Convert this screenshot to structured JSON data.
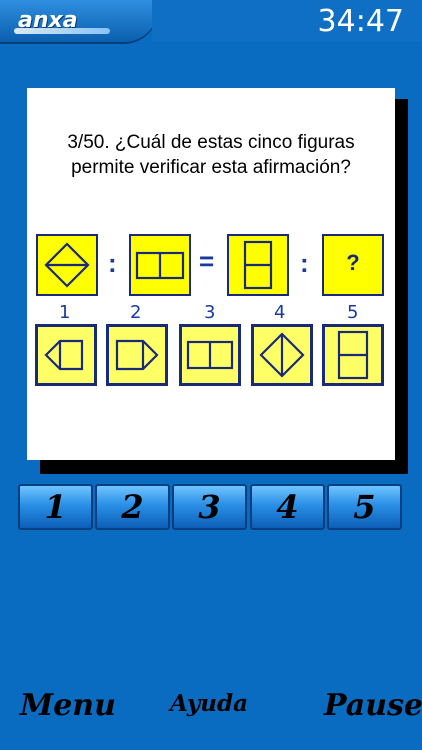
{
  "app": {
    "logo": "anxa",
    "timer": "34:47"
  },
  "question": {
    "line1": "3/50.  ¿Cuál de estas cinco figuras",
    "line2": "permite verificar esta afirmación?"
  },
  "equation": {
    "colon": ":",
    "equals": "=",
    "unknown": "?"
  },
  "options": {
    "numbers": [
      "1",
      "2",
      "3",
      "4",
      "5"
    ]
  },
  "answers": [
    "1",
    "2",
    "3",
    "4",
    "5"
  ],
  "bottom": {
    "menu": "Menu",
    "help": "Ayuda",
    "pause": "Pause"
  },
  "colors": {
    "background": "#0A6CC0",
    "figure_fill": "#FFFF00",
    "option_fill": "#FFFF66",
    "stroke": "#1A2A7A"
  }
}
